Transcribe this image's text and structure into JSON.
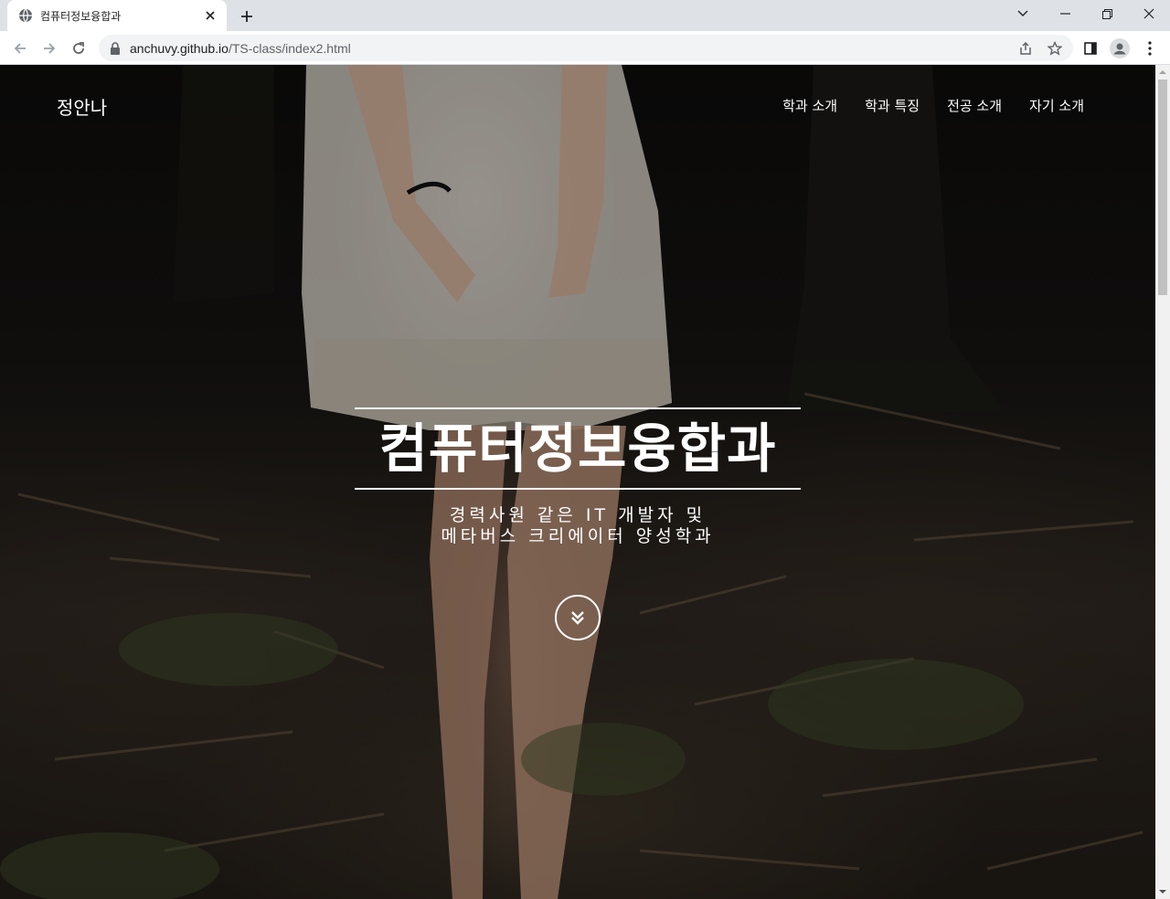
{
  "browser": {
    "tab_title": "컴퓨터정보융합과",
    "url_host": "anchuvy.github.io",
    "url_path": "/TS-class/index2.html"
  },
  "site": {
    "brand": "정안나",
    "nav": [
      "학과 소개",
      "학과 특징",
      "전공 소개",
      "자기 소개"
    ]
  },
  "hero": {
    "title": "컴퓨터정보융합과",
    "subtitle_line1": "경력사원 같은 IT 개발자 및",
    "subtitle_line2": "메타버스 크리에이터 양성학과"
  },
  "icons": {
    "favicon": "globe-icon",
    "scroll": "double-chevron-down-icon"
  }
}
